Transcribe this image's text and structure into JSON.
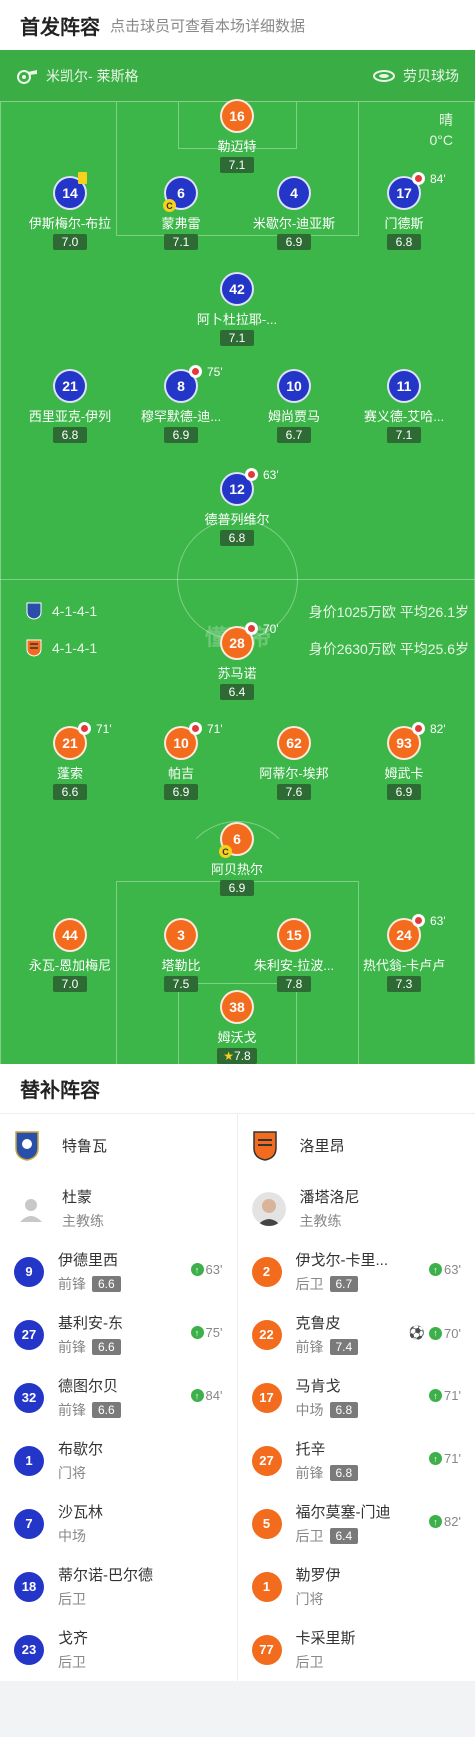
{
  "header": {
    "title": "首发阵容",
    "subtitle": "点击球员可查看本场详细数据"
  },
  "match_info": {
    "referee": "米凯尔- 莱斯格",
    "venue": "劳贝球场",
    "weather": "晴",
    "temperature": "0°C"
  },
  "watermark": "懂球帝",
  "home": {
    "formation": "4-1-4-1",
    "value_text": "身价1025万欧 平均26.1岁",
    "color": "#2436c8",
    "players": [
      {
        "num": "16",
        "name": "勒迈特",
        "rating": "7.1",
        "color": "orange"
      },
      {
        "num": "14",
        "name": "伊斯梅尔-布拉",
        "rating": "7.0",
        "yellow": true
      },
      {
        "num": "6",
        "name": "蒙弗雷",
        "rating": "7.1",
        "captain": "C"
      },
      {
        "num": "4",
        "name": "米歇尔-迪亚斯",
        "rating": "6.9"
      },
      {
        "num": "17",
        "name": "门德斯",
        "rating": "6.8",
        "sub_out": "84'"
      },
      {
        "num": "42",
        "name": "阿卜杜拉耶-...",
        "rating": "7.1"
      },
      {
        "num": "21",
        "name": "西里亚克-伊列",
        "rating": "6.8"
      },
      {
        "num": "8",
        "name": "穆罕默德-迪...",
        "rating": "6.9",
        "sub_out": "75'"
      },
      {
        "num": "10",
        "name": "姆尚贾马",
        "rating": "6.7"
      },
      {
        "num": "11",
        "name": "赛义德-艾哈...",
        "rating": "7.1"
      },
      {
        "num": "12",
        "name": "德普列维尔",
        "rating": "6.8",
        "sub_out": "63'"
      }
    ]
  },
  "away": {
    "formation": "4-1-4-1",
    "value_text": "身价2630万欧 平均25.6岁",
    "color": "#f36c1e",
    "players": [
      {
        "num": "28",
        "name": "苏马诺",
        "rating": "6.4",
        "sub_out": "70'"
      },
      {
        "num": "21",
        "name": "蓬索",
        "rating": "6.6",
        "sub_out": "71'"
      },
      {
        "num": "10",
        "name": "帕吉",
        "rating": "6.9",
        "sub_out": "71'"
      },
      {
        "num": "62",
        "name": "阿蒂尔-埃邦",
        "rating": "7.6"
      },
      {
        "num": "93",
        "name": "姆武卡",
        "rating": "6.9",
        "sub_out": "82'"
      },
      {
        "num": "6",
        "name": "阿贝热尔",
        "rating": "6.9",
        "captain": "C"
      },
      {
        "num": "44",
        "name": "永瓦-恩加梅尼",
        "rating": "7.0"
      },
      {
        "num": "3",
        "name": "塔勒比",
        "rating": "7.5"
      },
      {
        "num": "15",
        "name": "朱利安-拉波...",
        "rating": "7.8"
      },
      {
        "num": "24",
        "name": "热代翁-卡卢卢",
        "rating": "7.3",
        "sub_out": "63'"
      },
      {
        "num": "38",
        "name": "姆沃戈",
        "rating": "7.8",
        "mvp": "star"
      }
    ]
  },
  "subs": {
    "title": "替补阵容",
    "home_team": "特鲁瓦",
    "away_team": "洛里昂",
    "home_coach": {
      "name": "杜蒙",
      "role": "主教练"
    },
    "away_coach": {
      "name": "潘塔洛尼",
      "role": "主教练"
    },
    "home": [
      {
        "num": "9",
        "name": "伊德里西",
        "pos": "前锋",
        "rating": "6.6",
        "in": "63'"
      },
      {
        "num": "27",
        "name": "基利安-东",
        "pos": "前锋",
        "rating": "6.6",
        "in": "75'"
      },
      {
        "num": "32",
        "name": "德图尔贝",
        "pos": "前锋",
        "rating": "6.6",
        "in": "84'"
      },
      {
        "num": "1",
        "name": "布歇尔",
        "pos": "门将"
      },
      {
        "num": "7",
        "name": "沙瓦林",
        "pos": "中场"
      },
      {
        "num": "18",
        "name": "蒂尔诺-巴尔德",
        "pos": "后卫"
      },
      {
        "num": "23",
        "name": "戈齐",
        "pos": "后卫"
      }
    ],
    "away": [
      {
        "num": "2",
        "name": "伊戈尔-卡里...",
        "pos": "后卫",
        "rating": "6.7",
        "in": "63'"
      },
      {
        "num": "22",
        "name": "克鲁皮",
        "pos": "前锋",
        "rating": "7.4",
        "in": "70'",
        "goal": "soccer-ball-icon"
      },
      {
        "num": "17",
        "name": "马肯戈",
        "pos": "中场",
        "rating": "6.8",
        "in": "71'"
      },
      {
        "num": "27",
        "name": "托辛",
        "pos": "前锋",
        "rating": "6.8",
        "in": "71'"
      },
      {
        "num": "5",
        "name": "福尔莫塞-门迪",
        "pos": "后卫",
        "rating": "6.4",
        "in": "82'"
      },
      {
        "num": "1",
        "name": "勒罗伊",
        "pos": "门将"
      },
      {
        "num": "77",
        "name": "卡采里斯",
        "pos": "后卫"
      }
    ]
  }
}
